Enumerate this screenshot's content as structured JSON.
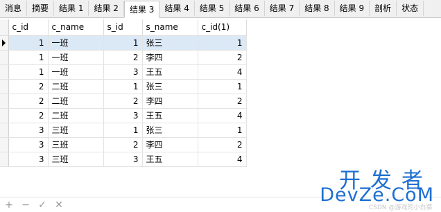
{
  "tabs": [
    {
      "label": "消息",
      "active": false
    },
    {
      "label": "摘要",
      "active": false
    },
    {
      "label": "结果 1",
      "active": false
    },
    {
      "label": "结果 2",
      "active": false
    },
    {
      "label": "结果 3",
      "active": true
    },
    {
      "label": "结果 4",
      "active": false
    },
    {
      "label": "结果 5",
      "active": false
    },
    {
      "label": "结果 6",
      "active": false
    },
    {
      "label": "结果 7",
      "active": false
    },
    {
      "label": "结果 8",
      "active": false
    },
    {
      "label": "结果 9",
      "active": false
    },
    {
      "label": "剖析",
      "active": false
    },
    {
      "label": "状态",
      "active": false
    }
  ],
  "grid": {
    "columns": [
      "c_id",
      "c_name",
      "s_id",
      "s_name",
      "c_id(1)"
    ],
    "rows": [
      [
        "1",
        "一班",
        "1",
        "张三",
        "1"
      ],
      [
        "1",
        "一班",
        "2",
        "李四",
        "2"
      ],
      [
        "1",
        "一班",
        "3",
        "王五",
        "4"
      ],
      [
        "2",
        "二班",
        "1",
        "张三",
        "1"
      ],
      [
        "2",
        "二班",
        "2",
        "李四",
        "2"
      ],
      [
        "2",
        "二班",
        "3",
        "王五",
        "4"
      ],
      [
        "3",
        "三班",
        "1",
        "张三",
        "1"
      ],
      [
        "3",
        "三班",
        "2",
        "李四",
        "2"
      ],
      [
        "3",
        "三班",
        "3",
        "王五",
        "4"
      ]
    ],
    "selected_row": 0
  },
  "toolbar": {
    "add": "+",
    "remove": "−",
    "apply": "✓",
    "cancel": "✕"
  },
  "watermark": {
    "title": "开发者",
    "url": "DevZe.CoM",
    "csdn": "CSDN @游戏的小白菜"
  },
  "colors": {
    "selected_row": "#dbe8f6",
    "watermark": "#1d6fd1"
  }
}
